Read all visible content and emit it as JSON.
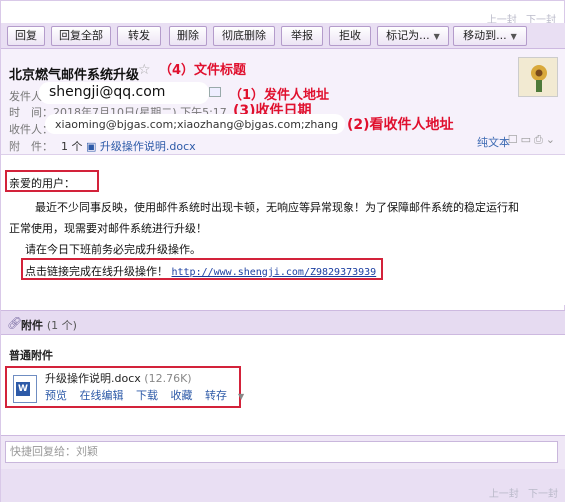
{
  "nav": {
    "prev": "上一封",
    "next": "下一封"
  },
  "toolbar": {
    "reply": "回复",
    "reply_all": "回复全部",
    "forward": "转发",
    "delete": "删除",
    "delete_permanently": "彻底删除",
    "report": "举报",
    "reject": "拒收",
    "mark_as": "标记为...",
    "move_to": "移动到..."
  },
  "header": {
    "subject": "北京燃气邮件系统升级",
    "sender_label": "发件人：",
    "sender": "shengji@qq.com",
    "time_label": "时　间：",
    "time": "2018年7月10日(星期二) 下午5:17",
    "recipient_label": "收件人：",
    "recipients": "xiaoming@bjgas.com;xiaozhang@bjgas.com;zhang",
    "attachment_label": "附　件：",
    "attachment_summary": "1 个",
    "attachment_file": "升级操作说明.docx",
    "plain_text": "纯文本"
  },
  "annotations": {
    "subject": "（4）文件标题",
    "sender": "（1）发件人地址",
    "date": "(3)收件日期",
    "recipients": "(2)看收件人地址"
  },
  "body": {
    "greeting": "亲爱的用户：",
    "line1": "最近不少同事反映，使用邮件系统时出现卡顿，无响应等异常现象！为了保障邮件系统的稳定运行和",
    "line2": "正常使用，现需要对邮件系统进行升级！",
    "line3": "请在今日下班前务必完成升级操作。",
    "link_prefix": "点击链接完成在线升级操作！",
    "link": "http://www.shengji.com/Z9829373939"
  },
  "attachments": {
    "bar_title": "附件",
    "bar_count": "(1 个)",
    "section_label": "普通附件",
    "file_name": "升级操作说明.docx",
    "file_size": "(12.76K)",
    "actions": [
      "预览",
      "在线编辑",
      "下载",
      "收藏",
      "转存"
    ]
  },
  "reply": {
    "placeholder": "快捷回复给：刘颖"
  },
  "colors": {
    "accent": "#e9dff3",
    "annotation_red": "#e0102e",
    "link_blue": "#2d5aa8"
  }
}
